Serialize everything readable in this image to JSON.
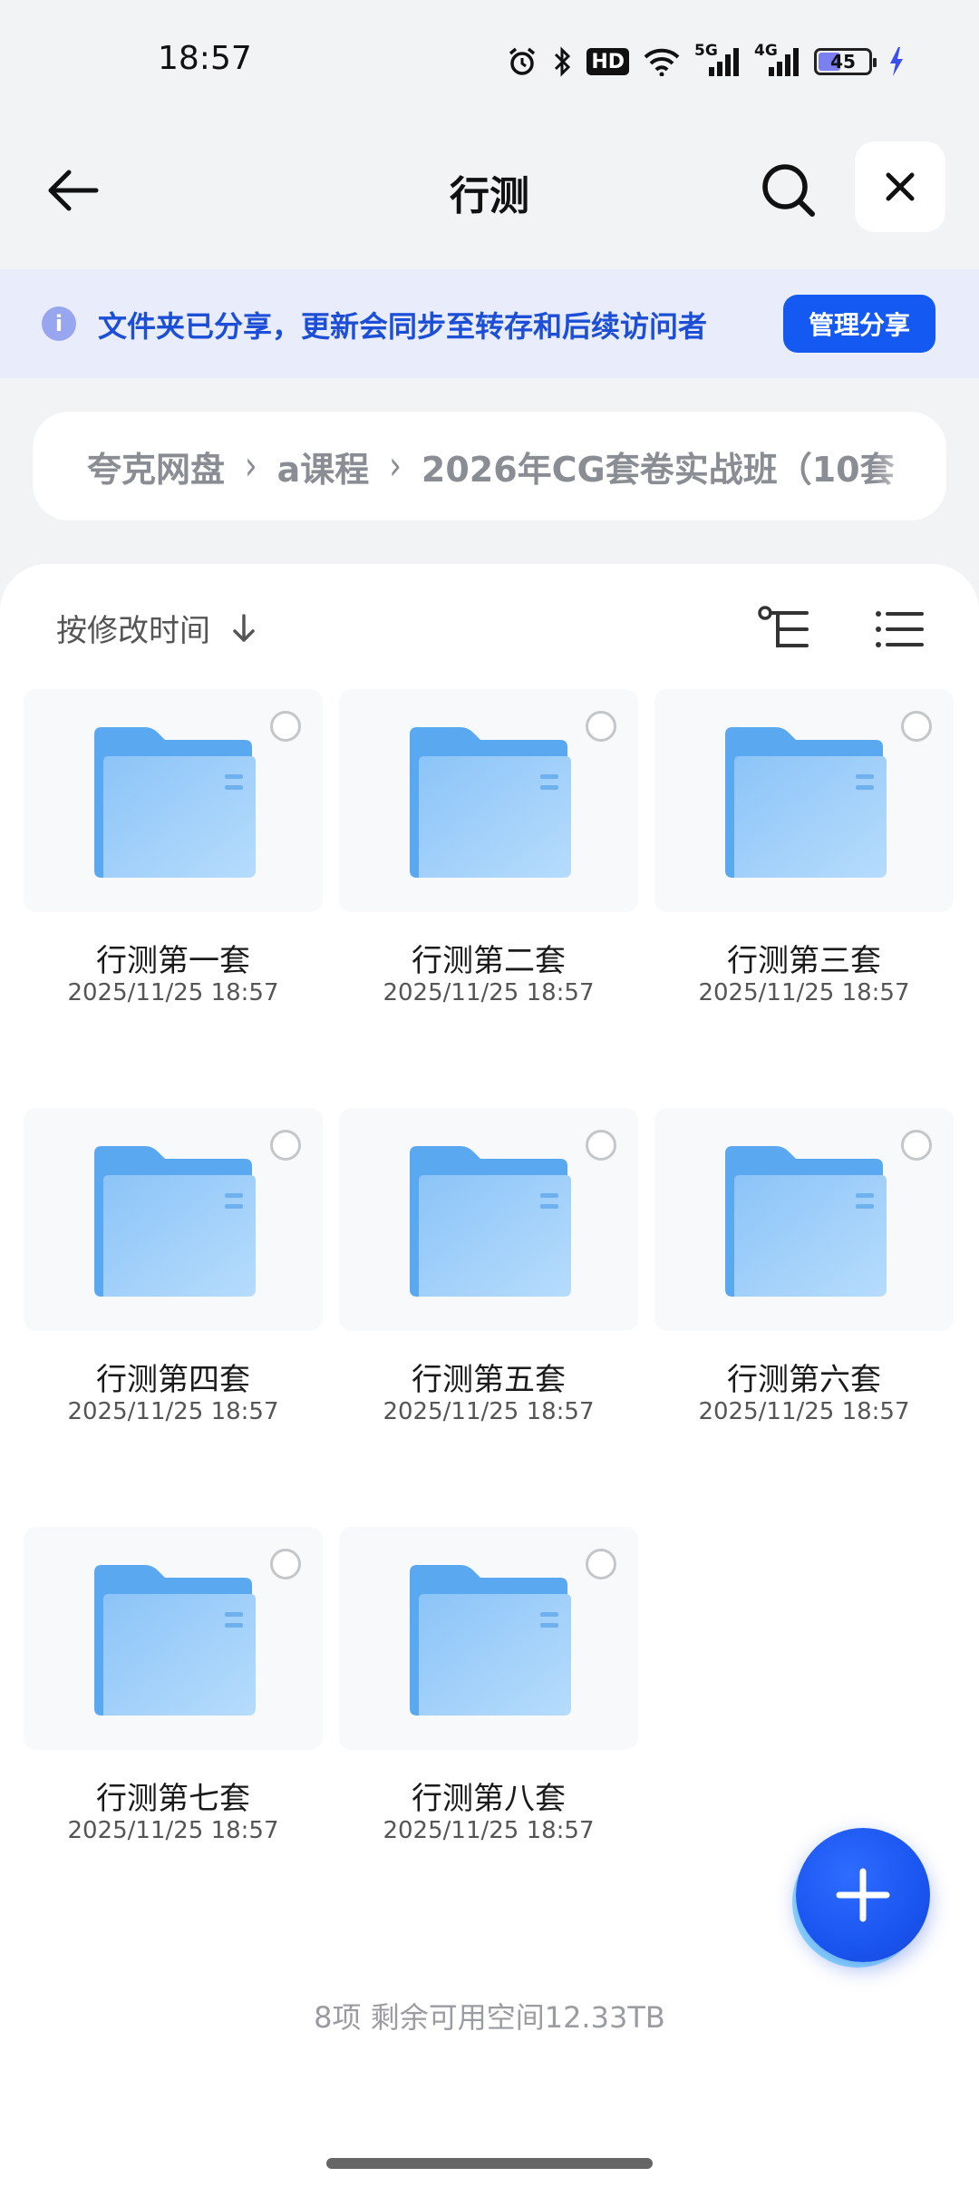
{
  "status_bar": {
    "time": "18:57",
    "hd_label": "HD",
    "signal_1_label": "5G",
    "signal_2_label": "4G",
    "battery_level": "45",
    "battery_fraction": 0.45,
    "icons": [
      "alarm-icon",
      "bluetooth-icon",
      "hd-icon",
      "wifi-icon",
      "signal-5g-icon",
      "signal-4g-icon",
      "battery-icon",
      "charging-icon"
    ]
  },
  "header": {
    "title": "行测"
  },
  "share_banner": {
    "text": "文件夹已分享，更新会同步至转存和后续访问者",
    "button_label": "管理分享",
    "info_glyph": "i"
  },
  "breadcrumb": {
    "items": [
      "夸克网盘",
      "a课程",
      "2026年CG套卷实战班（10套"
    ],
    "separator": "›"
  },
  "toolbar": {
    "sort_label": "按修改时间"
  },
  "folders": [
    {
      "name": "行测第一套",
      "date": "2025/11/25 18:57"
    },
    {
      "name": "行测第二套",
      "date": "2025/11/25 18:57"
    },
    {
      "name": "行测第三套",
      "date": "2025/11/25 18:57"
    },
    {
      "name": "行测第四套",
      "date": "2025/11/25 18:57"
    },
    {
      "name": "行测第五套",
      "date": "2025/11/25 18:57"
    },
    {
      "name": "行测第六套",
      "date": "2025/11/25 18:57"
    },
    {
      "name": "行测第七套",
      "date": "2025/11/25 18:57"
    },
    {
      "name": "行测第八套",
      "date": "2025/11/25 18:57"
    }
  ],
  "footer": {
    "info": "8项 剩余可用空间12.33TB"
  },
  "colors": {
    "accent": "#1559f3",
    "banner_bg": "#e8ecfb",
    "banner_text": "#1c4fd6",
    "folder_back": "#5aa8f0",
    "folder_front": "#9ccdfa"
  }
}
